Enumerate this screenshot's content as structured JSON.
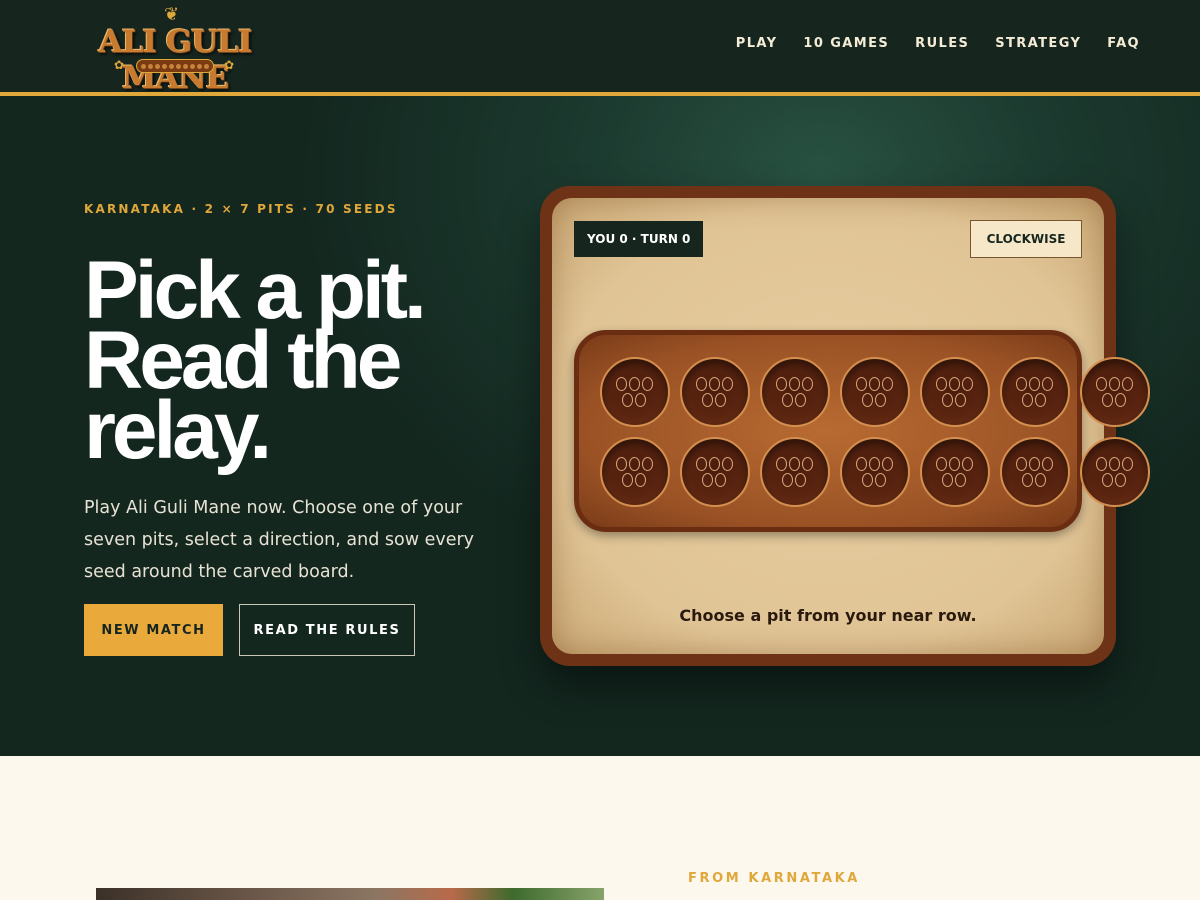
{
  "header": {
    "logo_text": "ALI GULI MANE",
    "nav": [
      "PLAY",
      "10 GAMES",
      "RULES",
      "STRATEGY",
      "FAQ"
    ]
  },
  "hero": {
    "eyebrow": "KARNATAKA · 2 × 7 PITS · 70 SEEDS",
    "headline": [
      "Pick a pit.",
      "Read the",
      "relay."
    ],
    "lede": "Play Ali Guli Mane now. Choose one of your seven pits, select a direction, and sow every seed around the carved board.",
    "primary_button": "NEW MATCH",
    "secondary_button": "READ THE RULES"
  },
  "board": {
    "score": "YOU 0 · TURN 0",
    "direction_button": "CLOCKWISE",
    "status": "Choose a pit from your near row.",
    "rows": [
      [
        5,
        5,
        5,
        5,
        5,
        5,
        5
      ],
      [
        5,
        5,
        5,
        5,
        5,
        5,
        5
      ]
    ]
  },
  "section2": {
    "eyebrow": "FROM KARNATAKA"
  },
  "colors": {
    "accent": "#e9a93b",
    "header_bg": "#16261f",
    "hero_bg": "#1c3a2f",
    "board_frame": "#6e3217",
    "board_surface": "#e0c495"
  },
  "icons": [
    "logo-emblem"
  ]
}
